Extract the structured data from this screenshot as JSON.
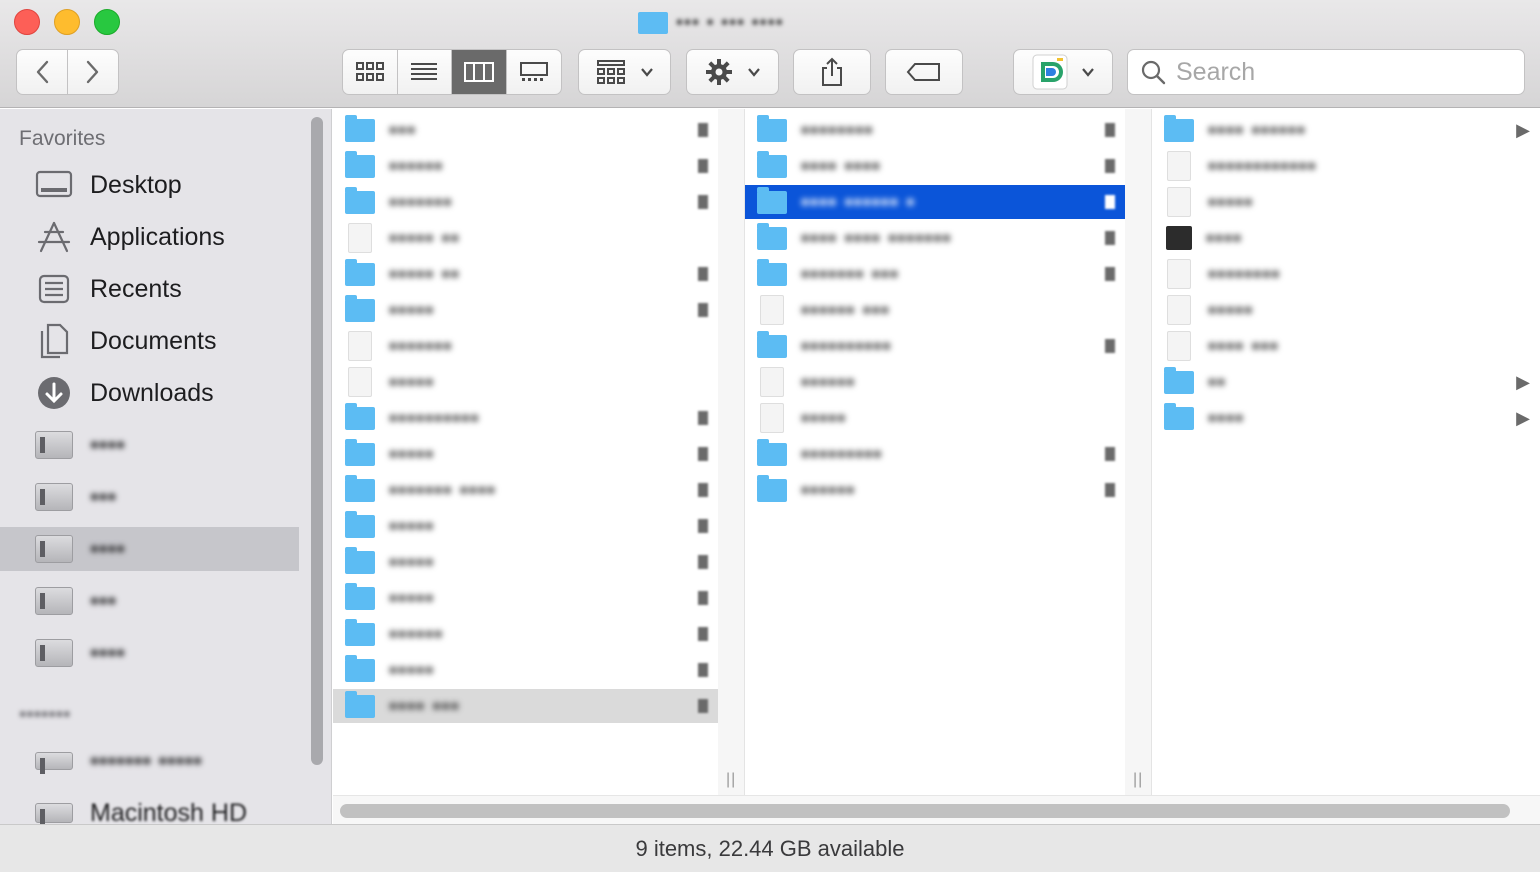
{
  "window": {
    "title": "••• • ••• ••••"
  },
  "toolbar": {
    "back_label": "‹",
    "forward_label": "›",
    "views": [
      {
        "name": "icon-view",
        "icon": "grid-icon",
        "active": false
      },
      {
        "name": "list-view",
        "icon": "list-icon",
        "active": false
      },
      {
        "name": "column-view",
        "icon": "columns-icon",
        "active": true
      },
      {
        "name": "gallery-view",
        "icon": "gallery-icon",
        "active": false
      }
    ],
    "arrange_icon": "group-icon",
    "action_icon": "gear-icon",
    "share_icon": "share-icon",
    "tag_icon": "tag-icon",
    "app_icon": "app-icon"
  },
  "search": {
    "placeholder": "Search",
    "value": ""
  },
  "sidebar": {
    "favorites_heading": "Favorites",
    "favorites": [
      {
        "label": "Desktop",
        "icon": "desktop-icon"
      },
      {
        "label": "Applications",
        "icon": "applications-icon"
      },
      {
        "label": "Recents",
        "icon": "recents-icon"
      },
      {
        "label": "Documents",
        "icon": "documents-icon"
      },
      {
        "label": "Downloads",
        "icon": "downloads-icon"
      },
      {
        "label": "••••",
        "icon": "folder-icon"
      },
      {
        "label": "•••",
        "icon": "folder-icon"
      },
      {
        "label": "••••",
        "icon": "folder-icon",
        "selected": true
      },
      {
        "label": "•••",
        "icon": "folder-icon"
      },
      {
        "label": "••••",
        "icon": "folder-icon"
      }
    ],
    "locations_heading": "•••••••",
    "locations": [
      {
        "label": "••••••• •••••",
        "icon": "drive-icon"
      },
      {
        "label": "Macintosh HD",
        "icon": "hard-drive-icon"
      }
    ]
  },
  "columns": [
    {
      "rows": [
        {
          "label": "•••",
          "kind": "folder",
          "mark": true
        },
        {
          "label": "••••••",
          "kind": "folder",
          "mark": true
        },
        {
          "label": "•••••••",
          "kind": "folder",
          "mark": true
        },
        {
          "label": "••••• ••",
          "kind": "doc",
          "mark": false
        },
        {
          "label": "••••• ••",
          "kind": "folder",
          "mark": true
        },
        {
          "label": "•••••",
          "kind": "folder",
          "mark": true
        },
        {
          "label": "•••••••",
          "kind": "doc",
          "mark": false
        },
        {
          "label": "•••••",
          "kind": "doc",
          "mark": false
        },
        {
          "label": "••••••••••",
          "kind": "folder",
          "mark": true
        },
        {
          "label": "•••••",
          "kind": "folder",
          "mark": true
        },
        {
          "label": "••••••• ••••",
          "kind": "folder",
          "mark": true
        },
        {
          "label": "•••••",
          "kind": "folder",
          "mark": true
        },
        {
          "label": "•••••",
          "kind": "folder",
          "mark": true
        },
        {
          "label": "•••••",
          "kind": "folder",
          "mark": true
        },
        {
          "label": "••••••",
          "kind": "folder",
          "mark": true
        },
        {
          "label": "•••••",
          "kind": "folder",
          "mark": true
        },
        {
          "label": "•••• •••",
          "kind": "folder",
          "mark": true,
          "highlight": true
        }
      ]
    },
    {
      "rows": [
        {
          "label": "••••••••",
          "kind": "folder",
          "mark": true
        },
        {
          "label": "•••• ••••",
          "kind": "folder",
          "mark": true
        },
        {
          "label": "•••• •••••• •",
          "kind": "folder",
          "mark": true,
          "selected": true
        },
        {
          "label": "•••• •••• •••••••",
          "kind": "folder",
          "mark": true
        },
        {
          "label": "••••••• •••",
          "kind": "folder",
          "mark": true
        },
        {
          "label": "•••••• •••",
          "kind": "doc",
          "mark": false
        },
        {
          "label": "••••••••••",
          "kind": "folder",
          "mark": true
        },
        {
          "label": "••••••",
          "kind": "doc",
          "mark": false
        },
        {
          "label": "•••••",
          "kind": "doc",
          "mark": false
        },
        {
          "label": "•••••••••",
          "kind": "folder",
          "mark": true
        },
        {
          "label": "••••••",
          "kind": "folder",
          "mark": true
        }
      ]
    },
    {
      "rows": [
        {
          "label": "•••• ••••••",
          "kind": "folder",
          "arrow": true
        },
        {
          "label": "••••••••••••",
          "kind": "doc",
          "arrow": false
        },
        {
          "label": "•••••",
          "kind": "doc",
          "arrow": false
        },
        {
          "label": "••••",
          "kind": "dark",
          "arrow": false
        },
        {
          "label": "••••••••",
          "kind": "doc",
          "arrow": false
        },
        {
          "label": "•••••",
          "kind": "doc",
          "arrow": false
        },
        {
          "label": "•••• •••",
          "kind": "doc",
          "arrow": false
        },
        {
          "label": "••",
          "kind": "folder",
          "arrow": true
        },
        {
          "label": "••••",
          "kind": "folder",
          "arrow": true
        }
      ]
    }
  ],
  "status": {
    "text": "9 items, 22.44 GB available"
  },
  "colors": {
    "folder": "#5cbcf3",
    "selection": "#0b55d9",
    "sidebar_bg": "#e5e4e8"
  }
}
